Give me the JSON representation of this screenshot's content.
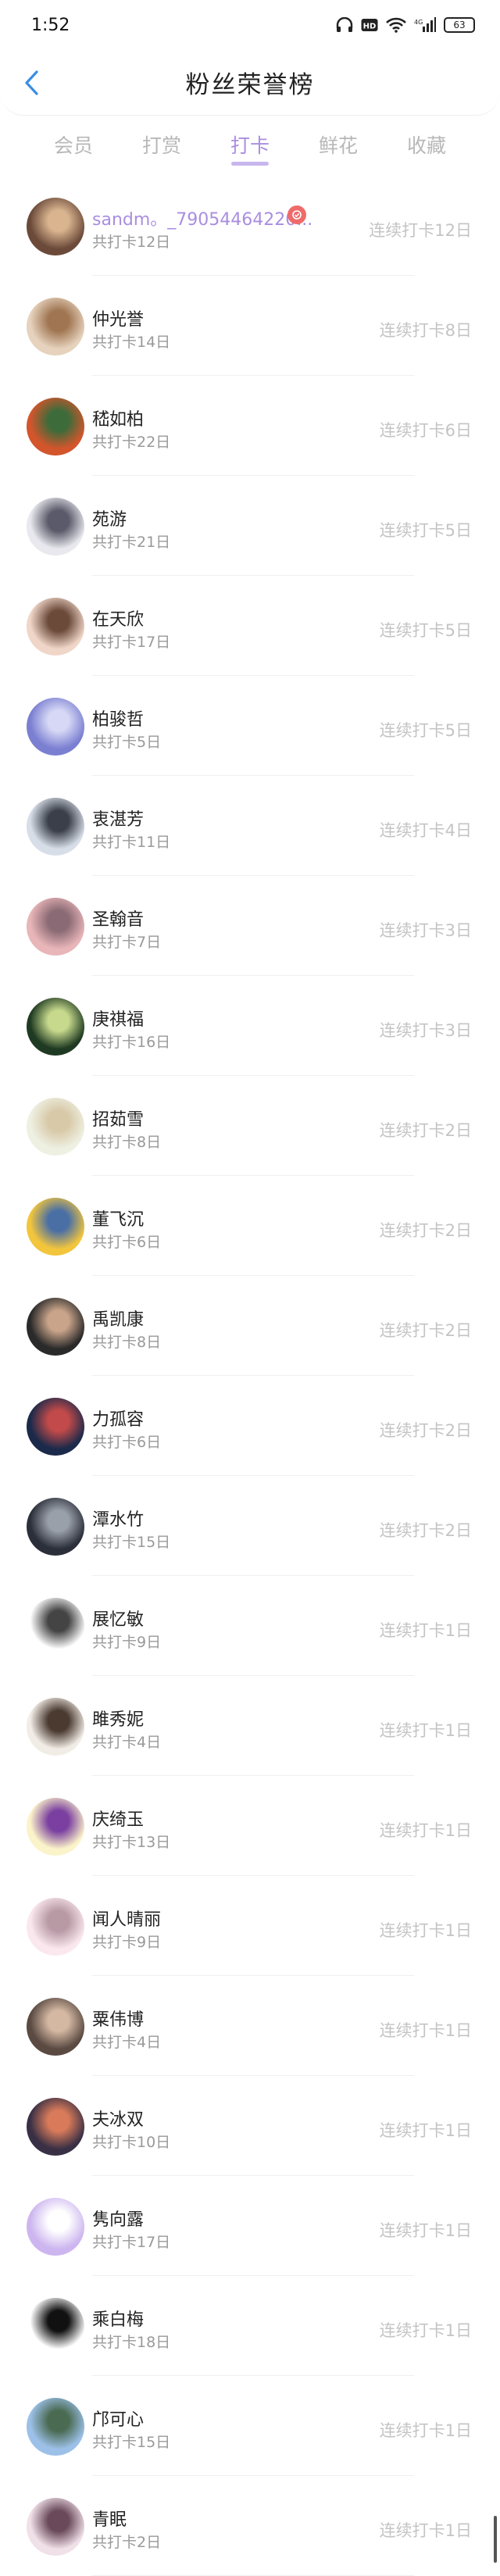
{
  "status": {
    "time": "1:52",
    "battery": "63"
  },
  "header": {
    "title": "粉丝荣誉榜"
  },
  "tabs": [
    {
      "label": "会员"
    },
    {
      "label": "打赏"
    },
    {
      "label": "打卡",
      "active": true
    },
    {
      "label": "鲜花"
    },
    {
      "label": "收藏"
    }
  ],
  "colors": {
    "accent": "#a98ee0",
    "badge": "#ef6b6b"
  },
  "rows": [
    {
      "name": "sandm。_790544642​20...",
      "total": "共打卡12日",
      "streak": "连续打卡12日",
      "self": true,
      "avatar": [
        "#6b4a3a",
        "#d9b48f"
      ]
    },
    {
      "name": "仲光誉",
      "total": "共打卡14日",
      "streak": "连续打卡8日",
      "avatar": [
        "#e6d2bd",
        "#a07652"
      ]
    },
    {
      "name": "嵇如柏",
      "total": "共打卡22日",
      "streak": "连续打卡6日",
      "avatar": [
        "#d3552c",
        "#3e6b3a"
      ]
    },
    {
      "name": "苑游",
      "total": "共打卡21日",
      "streak": "连续打卡5日",
      "avatar": [
        "#e8e8ee",
        "#5a5a6a"
      ]
    },
    {
      "name": "在天欣",
      "total": "共打卡17日",
      "streak": "连续打卡5日",
      "avatar": [
        "#f0d6c8",
        "#6b4a3a"
      ]
    },
    {
      "name": "柏骏哲",
      "total": "共打卡5日",
      "streak": "连续打卡5日",
      "avatar": [
        "#7b7fd1",
        "#d6d8f5"
      ]
    },
    {
      "name": "衷湛芳",
      "total": "共打卡11日",
      "streak": "连续打卡4日",
      "avatar": [
        "#d8dee8",
        "#3a3f4a"
      ]
    },
    {
      "name": "圣翰音",
      "total": "共打卡7日",
      "streak": "连续打卡3日",
      "avatar": [
        "#e8b5b8",
        "#8a6a74"
      ]
    },
    {
      "name": "庚祺福",
      "total": "共打卡16日",
      "streak": "连续打卡3日",
      "avatar": [
        "#1f3a22",
        "#c7d98c"
      ]
    },
    {
      "name": "招茹雪",
      "total": "共打卡8日",
      "streak": "连续打卡2日",
      "avatar": [
        "#eef0e2",
        "#d8c9a8"
      ]
    },
    {
      "name": "董飞沉",
      "total": "共打卡6日",
      "streak": "连续打卡2日",
      "avatar": [
        "#f2c53d",
        "#4a6fa5"
      ]
    },
    {
      "name": "禹凯康",
      "total": "共打卡8日",
      "streak": "连续打卡2日",
      "avatar": [
        "#2a2a2a",
        "#c9a48a"
      ]
    },
    {
      "name": "力孤容",
      "total": "共打卡6日",
      "streak": "连续打卡2日",
      "avatar": [
        "#1b2a4a",
        "#c24a4a"
      ]
    },
    {
      "name": "潭水竹",
      "total": "共打卡15日",
      "streak": "连续打卡2日",
      "avatar": [
        "#2b2f3a",
        "#9aa0aa"
      ]
    },
    {
      "name": "展忆敏",
      "total": "共打卡9日",
      "streak": "连续打卡1日",
      "avatar": [
        "#ffffff",
        "#444444"
      ]
    },
    {
      "name": "雎秀妮",
      "total": "共打卡4日",
      "streak": "连续打卡1日",
      "avatar": [
        "#f1ece6",
        "#4a3a30"
      ]
    },
    {
      "name": "庆绮玉",
      "total": "共打卡13日",
      "streak": "连续打卡1日",
      "avatar": [
        "#fbf3c9",
        "#7a3fa0"
      ]
    },
    {
      "name": "闻人晴丽",
      "total": "共打卡9日",
      "streak": "连续打卡1日",
      "avatar": [
        "#fbe8ef",
        "#b89aa5"
      ]
    },
    {
      "name": "粟伟博",
      "total": "共打卡4日",
      "streak": "连续打卡1日",
      "avatar": [
        "#5a4a42",
        "#d4b8a2"
      ]
    },
    {
      "name": "夫冰双",
      "total": "共打卡10日",
      "streak": "连续打卡1日",
      "avatar": [
        "#3a3045",
        "#d97b5a"
      ]
    },
    {
      "name": "隽向露",
      "total": "共打卡17日",
      "streak": "连续打卡1日",
      "avatar": [
        "#cdb6ef",
        "#ffffff"
      ]
    },
    {
      "name": "乘白梅",
      "total": "共打卡18日",
      "streak": "连续打卡1日",
      "avatar": [
        "#ffffff",
        "#111111"
      ]
    },
    {
      "name": "邝可心",
      "total": "共打卡15日",
      "streak": "连续打卡1日",
      "avatar": [
        "#9cc0e8",
        "#4a6a52"
      ]
    },
    {
      "name": "青眠",
      "total": "共打卡2日",
      "streak": "连续打卡1日",
      "avatar": [
        "#f0e0e8",
        "#6a4a5a"
      ]
    }
  ]
}
